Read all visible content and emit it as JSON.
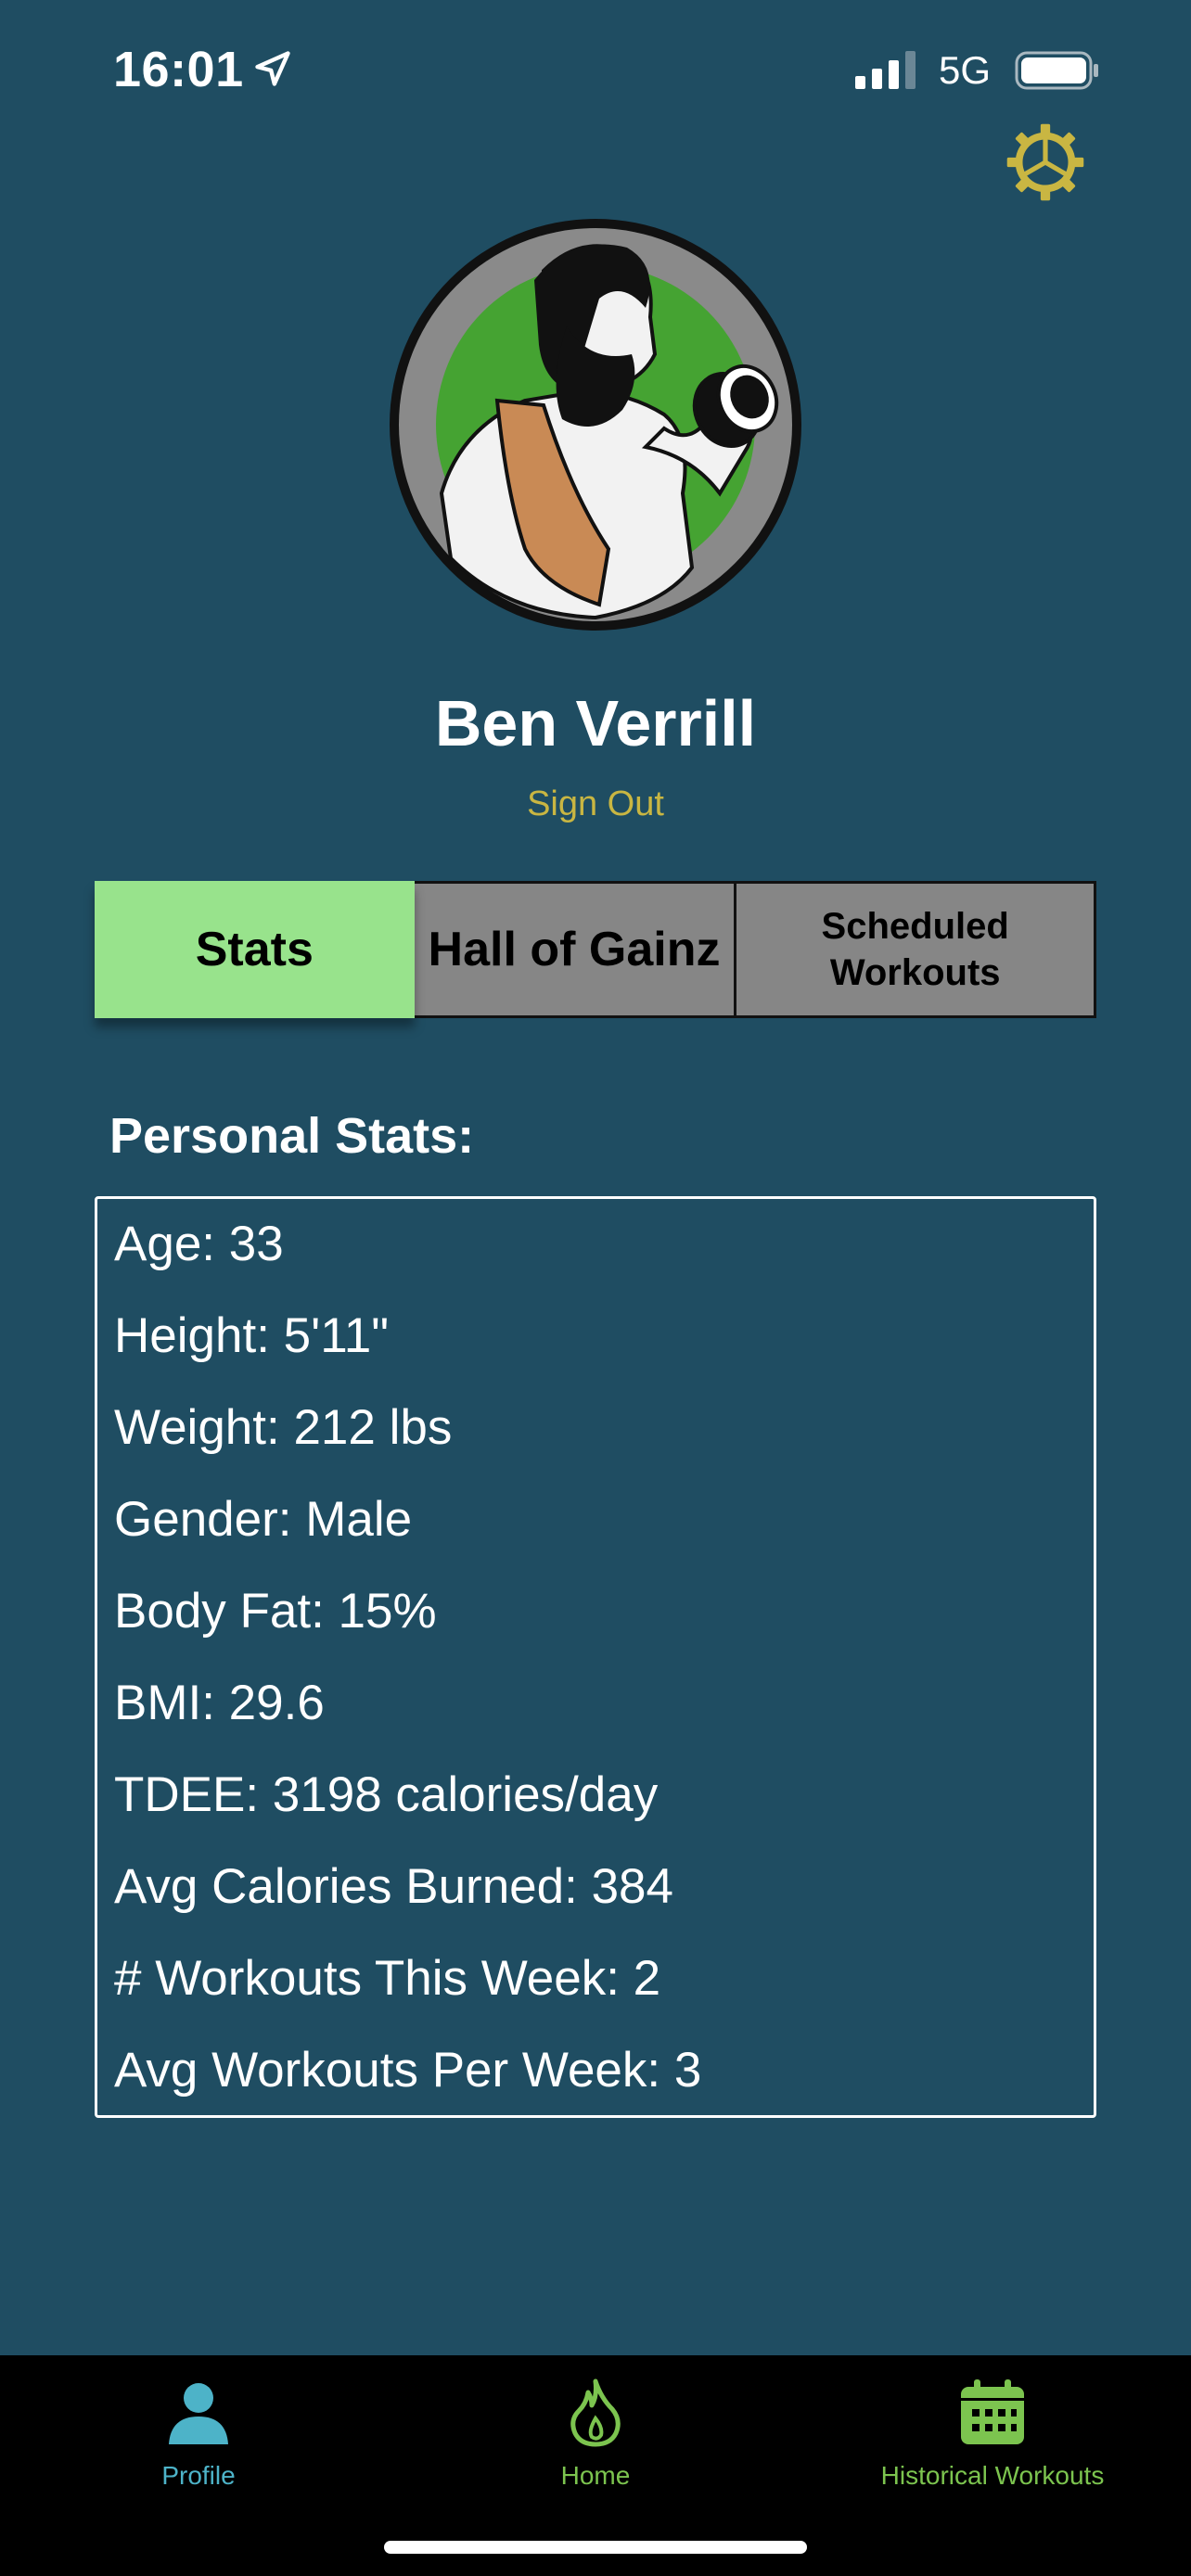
{
  "status_bar": {
    "time": "16:01",
    "network": "5G",
    "icons": [
      "location-arrow-icon",
      "signal-icon",
      "battery-icon"
    ]
  },
  "header": {
    "settings_icon": "gear-icon",
    "settings_color": "#c9b642"
  },
  "profile": {
    "name": "Ben Verrill",
    "sign_out_label": "Sign Out",
    "avatar_icon": "bearded-lifter-avatar-icon"
  },
  "tabs": [
    {
      "label": "Stats",
      "active": true
    },
    {
      "label": "Hall of Gainz",
      "active": false
    },
    {
      "label": "Scheduled Workouts",
      "active": false
    }
  ],
  "stats": {
    "heading": "Personal Stats:",
    "rows": [
      "Age: 33",
      "Height: 5'11\"",
      "Weight: 212 lbs",
      "Gender: Male",
      "Body Fat: 15%",
      "BMI: 29.6",
      "TDEE: 3198 calories/day",
      "Avg Calories Burned: 384",
      "# Workouts This Week: 2",
      "Avg Workouts Per Week: 3"
    ]
  },
  "tab_bar": {
    "items": [
      {
        "label": "Profile",
        "icon": "person-icon",
        "color": "#4db3c8",
        "selected": true
      },
      {
        "label": "Home",
        "icon": "flame-icon",
        "color": "#7cc44f",
        "selected": false
      },
      {
        "label": "Historical Workouts",
        "icon": "calendar-icon",
        "color": "#7cc44f",
        "selected": false
      }
    ]
  },
  "colors": {
    "background": "#1f4d62",
    "active_tab": "#98e38c",
    "inactive_tab": "#868686",
    "accent_gold": "#c9b642"
  }
}
